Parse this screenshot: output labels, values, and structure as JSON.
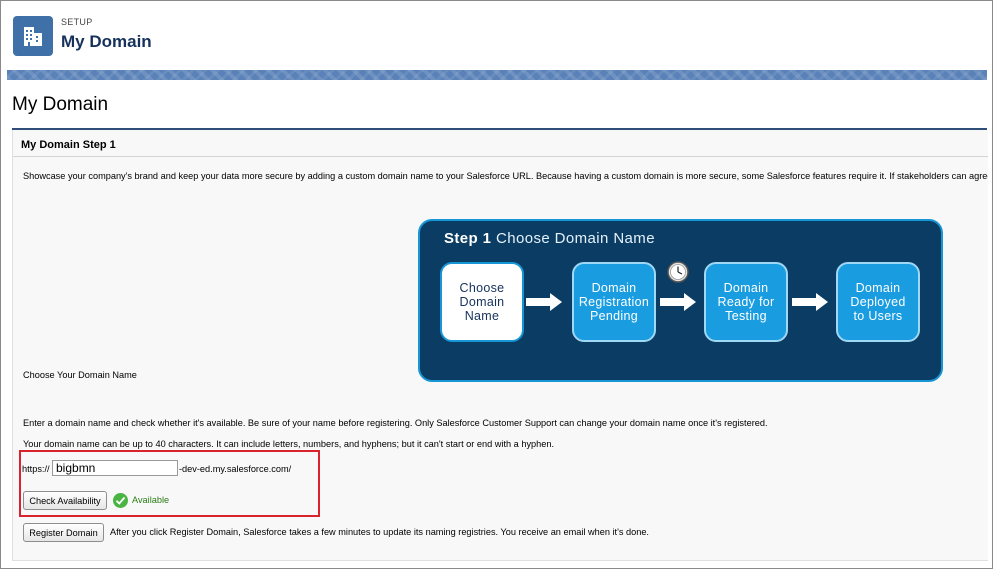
{
  "header": {
    "kicker": "SETUP",
    "title": "My Domain",
    "icon": "building-icon",
    "icon_color": "#3f70a7"
  },
  "page": {
    "title": "My Domain"
  },
  "step": {
    "heading": "My Domain Step 1",
    "intro": "Showcase your company's brand and keep your data more secure by adding a custom domain name to your Salesforce URL. Because having a custom domain is more secure, some Salesforce features require it. If stakeholders can agree on."
  },
  "diagram": {
    "title_strong": "Step 1",
    "title_rest": "Choose Domain Name",
    "background": "#0b3c63",
    "accent": "#1a9ce0",
    "steps": [
      {
        "label": "Choose Domain Name",
        "line1": "Choose",
        "line2": "Domain",
        "line3": "Name"
      },
      {
        "label": "Domain Registration Pending",
        "line1": "Domain",
        "line2": "Registration",
        "line3": "Pending"
      },
      {
        "label": "Domain Ready for Testing",
        "line1": "Domain",
        "line2": "Ready for",
        "line3": "Testing"
      },
      {
        "label": "Domain Deployed to Users",
        "line1": "Domain",
        "line2": "Deployed",
        "line3": "to Users"
      }
    ],
    "clock_icon": "clock-icon"
  },
  "form": {
    "section_label": "Choose Your Domain Name",
    "help1": "Enter a domain name and check whether it's available. Be sure of your name before registering. Only Salesforce Customer Support can change your domain name once it's registered.",
    "help2": "Your domain name can be up to 40 characters. It can include letters, numbers, and hyphens; but it can't start or end with a hyphen.",
    "prefix": "https://",
    "domain_value": "bigbmn",
    "suffix": "-dev-ed.my.salesforce.com/",
    "check_button": "Check Availability",
    "availability_status": "Available",
    "status_color": "#2b7d16",
    "register_button": "Register Domain",
    "register_note": "After you click Register Domain, Salesforce takes a few minutes to update its naming registries. You receive an email when it's done."
  }
}
